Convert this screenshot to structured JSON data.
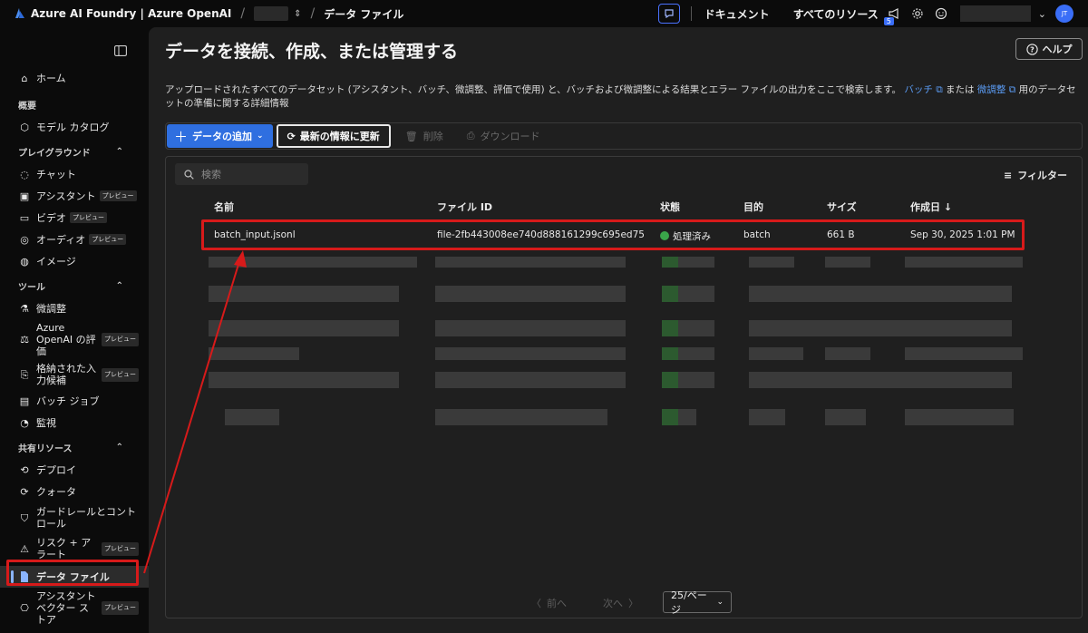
{
  "topbar": {
    "brand": "Azure AI Foundry | Azure OpenAI",
    "breadcrumb_current": "データ ファイル",
    "docs_link": "ドキュメント",
    "all_resources": "すべてのリソース",
    "notification_count": "5",
    "avatar_initials": "JT"
  },
  "sidebar": {
    "home": "ホーム",
    "section_overview": "概要",
    "model_catalog": "モデル カタログ",
    "section_playground": "プレイグラウンド",
    "chat": "チャット",
    "assistant": "アシスタント",
    "video": "ビデオ",
    "audio": "オーディオ",
    "image": "イメージ",
    "section_tools": "ツール",
    "finetune": "微調整",
    "eval": "Azure\nOpenAI の評\n価",
    "stored": "格納された入\n力候補",
    "batch": "バッチ ジョブ",
    "monitor": "監視",
    "section_shared": "共有リソース",
    "deploy": "デプロイ",
    "quota": "クォータ",
    "guardrails": "ガードレールとコント\nロール",
    "risk": "リスク + ア\nラート",
    "data_files": "データ ファイル",
    "vector": "アシスタント\nベクター ス\nトア",
    "preview": "プレビュー"
  },
  "main": {
    "title": "データを接続、作成、または管理する",
    "help": "ヘルプ",
    "desc_part1": "アップロードされたすべてのデータセット (アシスタント、バッチ、微調整、評価で使用) と、バッチおよび微調整による結果とエラー ファイルの出力をここで検索します。",
    "link_batch": "バッチ",
    "desc_or": "または",
    "link_finetune": "微調整",
    "desc_part2": "用のデータセットの準備に関する詳細情報",
    "add_data": "データの追加",
    "refresh": "最新の情報に更新",
    "delete": "削除",
    "download": "ダウンロード",
    "search_placeholder": "検索",
    "filter": "フィルター"
  },
  "table": {
    "headers": {
      "name": "名前",
      "file_id": "ファイル ID",
      "status": "状態",
      "purpose": "目的",
      "size": "サイズ",
      "created": "作成日 ↓"
    },
    "row": {
      "name": "batch_input.jsonl",
      "file_id": "file-2fb443008ee740d888161299c695ed75",
      "status": "処理済み",
      "purpose": "batch",
      "size": "661 B",
      "created": "Sep 30, 2025 1:01 PM"
    }
  },
  "pager": {
    "prev": "前へ",
    "next": "次へ",
    "page_size": "25/ページ"
  },
  "colors": {
    "accent": "#2f6fe0",
    "highlight": "#d71a1a",
    "success": "#3aa54a"
  }
}
